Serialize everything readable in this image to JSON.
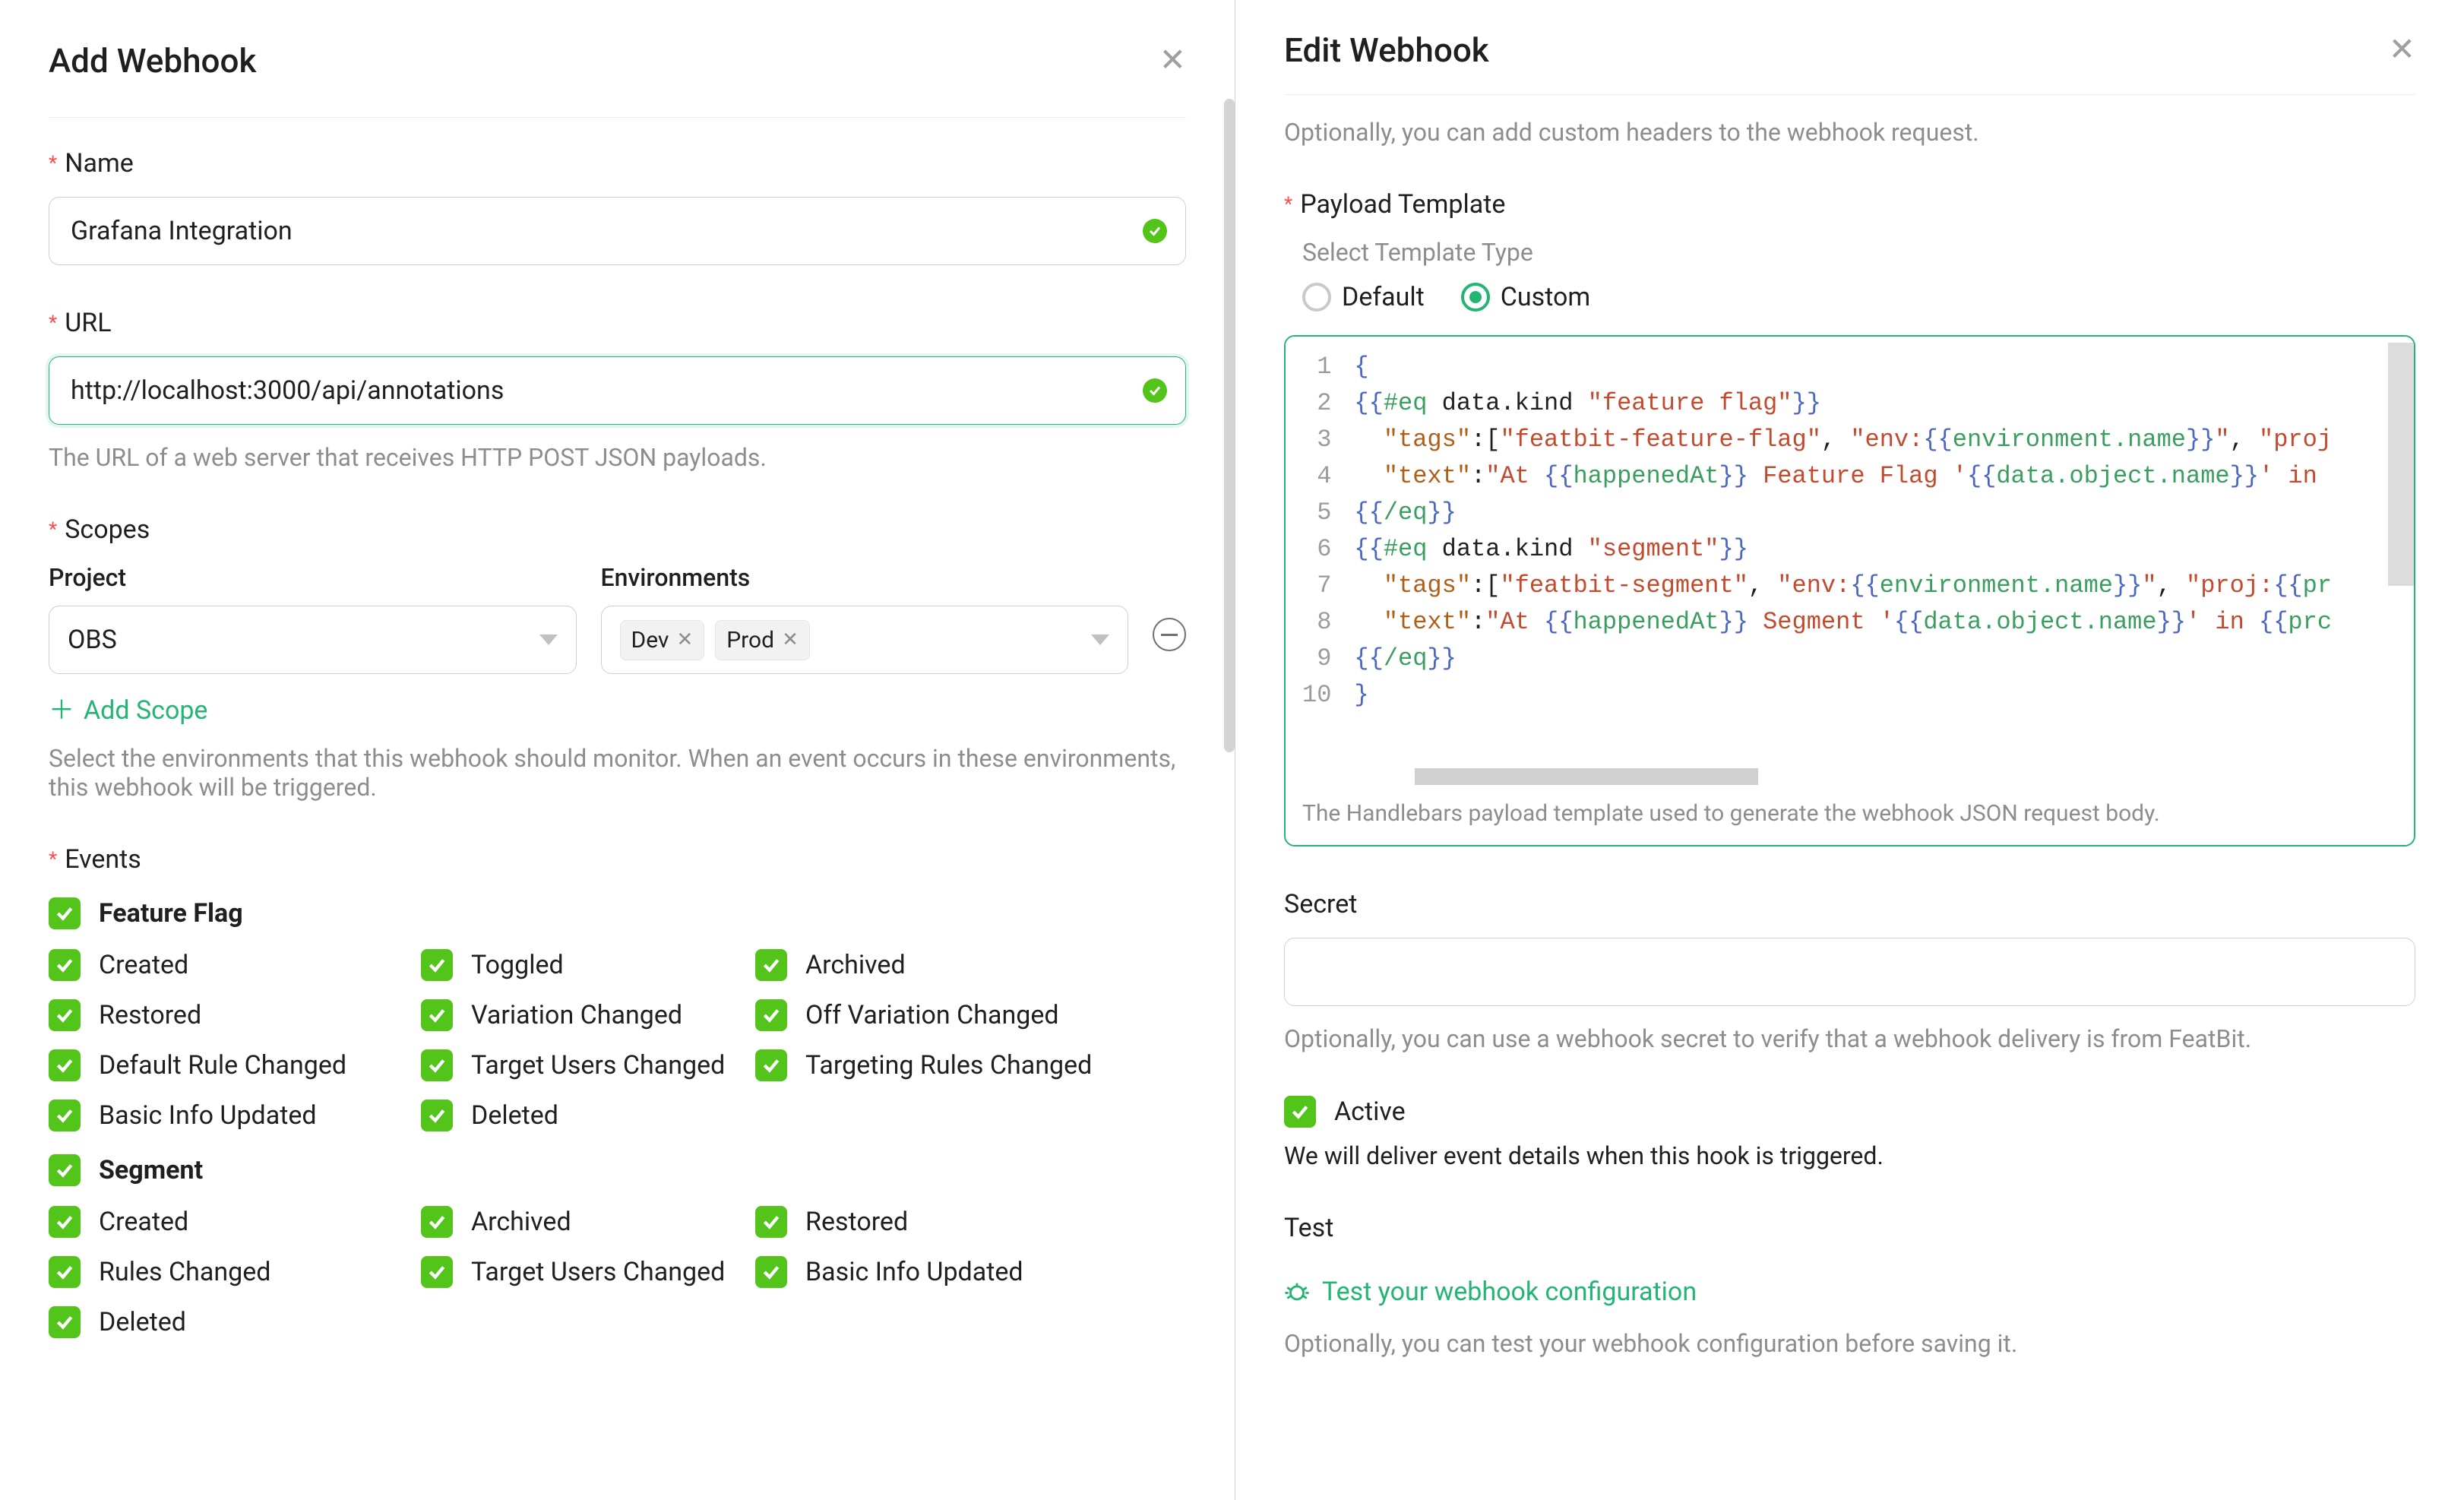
{
  "left": {
    "title": "Add Webhook",
    "name": {
      "label": "Name",
      "value": "Grafana Integration"
    },
    "url": {
      "label": "URL",
      "value": "http://localhost:3000/api/annotations",
      "help": "The URL of a web server that receives HTTP POST JSON payloads."
    },
    "scopes": {
      "label": "Scopes",
      "project_label": "Project",
      "project_value": "OBS",
      "env_label": "Environments",
      "env_tags": [
        "Dev",
        "Prod"
      ],
      "add_label": "Add Scope",
      "help": "Select the environments that this webhook should monitor. When an event occurs in these environments, this webhook will be triggered."
    },
    "events": {
      "label": "Events",
      "groups": [
        {
          "name": "Feature Flag",
          "items": [
            "Created",
            "Toggled",
            "Archived",
            "Restored",
            "Variation Changed",
            "Off Variation Changed",
            "Default Rule Changed",
            "Target Users Changed",
            "Targeting Rules Changed",
            "Basic Info Updated",
            "Deleted"
          ]
        },
        {
          "name": "Segment",
          "items": [
            "Created",
            "Archived",
            "Restored",
            "Rules Changed",
            "Target Users Changed",
            "Basic Info Updated",
            "Deleted"
          ]
        }
      ]
    }
  },
  "right": {
    "title": "Edit Webhook",
    "headers_help": "Optionally, you can add custom headers to the webhook request.",
    "payload": {
      "label": "Payload Template",
      "type_label": "Select Template Type",
      "options": {
        "default": "Default",
        "custom": "Custom"
      },
      "selected": "custom",
      "code_lines": [
        {
          "n": 1,
          "tokens": [
            [
              "delim",
              "{"
            ]
          ]
        },
        {
          "n": 2,
          "tokens": [
            [
              "delim",
              "{{"
            ],
            [
              "block",
              "#eq"
            ],
            [
              "plain",
              " data.kind "
            ],
            [
              "str",
              "\"feature flag\""
            ],
            [
              "delim",
              "}}"
            ]
          ]
        },
        {
          "n": 3,
          "tokens": [
            [
              "plain",
              "  "
            ],
            [
              "key",
              "\"tags\""
            ],
            [
              "plain",
              ":["
            ],
            [
              "str",
              "\"featbit-feature-flag\""
            ],
            [
              "plain",
              ", "
            ],
            [
              "str",
              "\"env:"
            ],
            [
              "delim",
              "{{"
            ],
            [
              "var",
              "environment.name"
            ],
            [
              "delim",
              "}}"
            ],
            [
              "str",
              "\""
            ],
            [
              "plain",
              ", "
            ],
            [
              "str",
              "\"proj"
            ]
          ]
        },
        {
          "n": 4,
          "tokens": [
            [
              "plain",
              "  "
            ],
            [
              "key",
              "\"text\""
            ],
            [
              "plain",
              ":"
            ],
            [
              "str",
              "\"At "
            ],
            [
              "delim",
              "{{"
            ],
            [
              "var",
              "happenedAt"
            ],
            [
              "delim",
              "}}"
            ],
            [
              "str",
              " Feature Flag '"
            ],
            [
              "delim",
              "{{"
            ],
            [
              "var",
              "data.object.name"
            ],
            [
              "delim",
              "}}"
            ],
            [
              "str",
              "' in"
            ]
          ]
        },
        {
          "n": 5,
          "tokens": [
            [
              "delim",
              "{{"
            ],
            [
              "block",
              "/eq"
            ],
            [
              "delim",
              "}}"
            ]
          ]
        },
        {
          "n": 6,
          "tokens": [
            [
              "delim",
              "{{"
            ],
            [
              "block",
              "#eq"
            ],
            [
              "plain",
              " data.kind "
            ],
            [
              "str",
              "\"segment\""
            ],
            [
              "delim",
              "}}"
            ]
          ]
        },
        {
          "n": 7,
          "tokens": [
            [
              "plain",
              "  "
            ],
            [
              "key",
              "\"tags\""
            ],
            [
              "plain",
              ":["
            ],
            [
              "str",
              "\"featbit-segment\""
            ],
            [
              "plain",
              ", "
            ],
            [
              "str",
              "\"env:"
            ],
            [
              "delim",
              "{{"
            ],
            [
              "var",
              "environment.name"
            ],
            [
              "delim",
              "}}"
            ],
            [
              "str",
              "\""
            ],
            [
              "plain",
              ", "
            ],
            [
              "str",
              "\"proj:"
            ],
            [
              "delim",
              "{{"
            ],
            [
              "var",
              "pr"
            ]
          ]
        },
        {
          "n": 8,
          "tokens": [
            [
              "plain",
              "  "
            ],
            [
              "key",
              "\"text\""
            ],
            [
              "plain",
              ":"
            ],
            [
              "str",
              "\"At "
            ],
            [
              "delim",
              "{{"
            ],
            [
              "var",
              "happenedAt"
            ],
            [
              "delim",
              "}}"
            ],
            [
              "str",
              " Segment '"
            ],
            [
              "delim",
              "{{"
            ],
            [
              "var",
              "data.object.name"
            ],
            [
              "delim",
              "}}"
            ],
            [
              "str",
              "' in "
            ],
            [
              "delim",
              "{{"
            ],
            [
              "var",
              "prc"
            ]
          ]
        },
        {
          "n": 9,
          "tokens": [
            [
              "delim",
              "{{"
            ],
            [
              "block",
              "/eq"
            ],
            [
              "delim",
              "}}"
            ]
          ]
        },
        {
          "n": 10,
          "tokens": [
            [
              "delim",
              "}"
            ]
          ]
        }
      ],
      "help": "The Handlebars payload template used to generate the webhook JSON request body."
    },
    "secret": {
      "label": "Secret",
      "value": "",
      "help": "Optionally, you can use a webhook secret to verify that a webhook delivery is from FeatBit."
    },
    "active": {
      "label": "Active",
      "checked": true,
      "help": "We will deliver event details when this hook is triggered."
    },
    "test": {
      "label": "Test",
      "link": "Test your webhook configuration",
      "help": "Optionally, you can test your webhook configuration before saving it."
    }
  }
}
